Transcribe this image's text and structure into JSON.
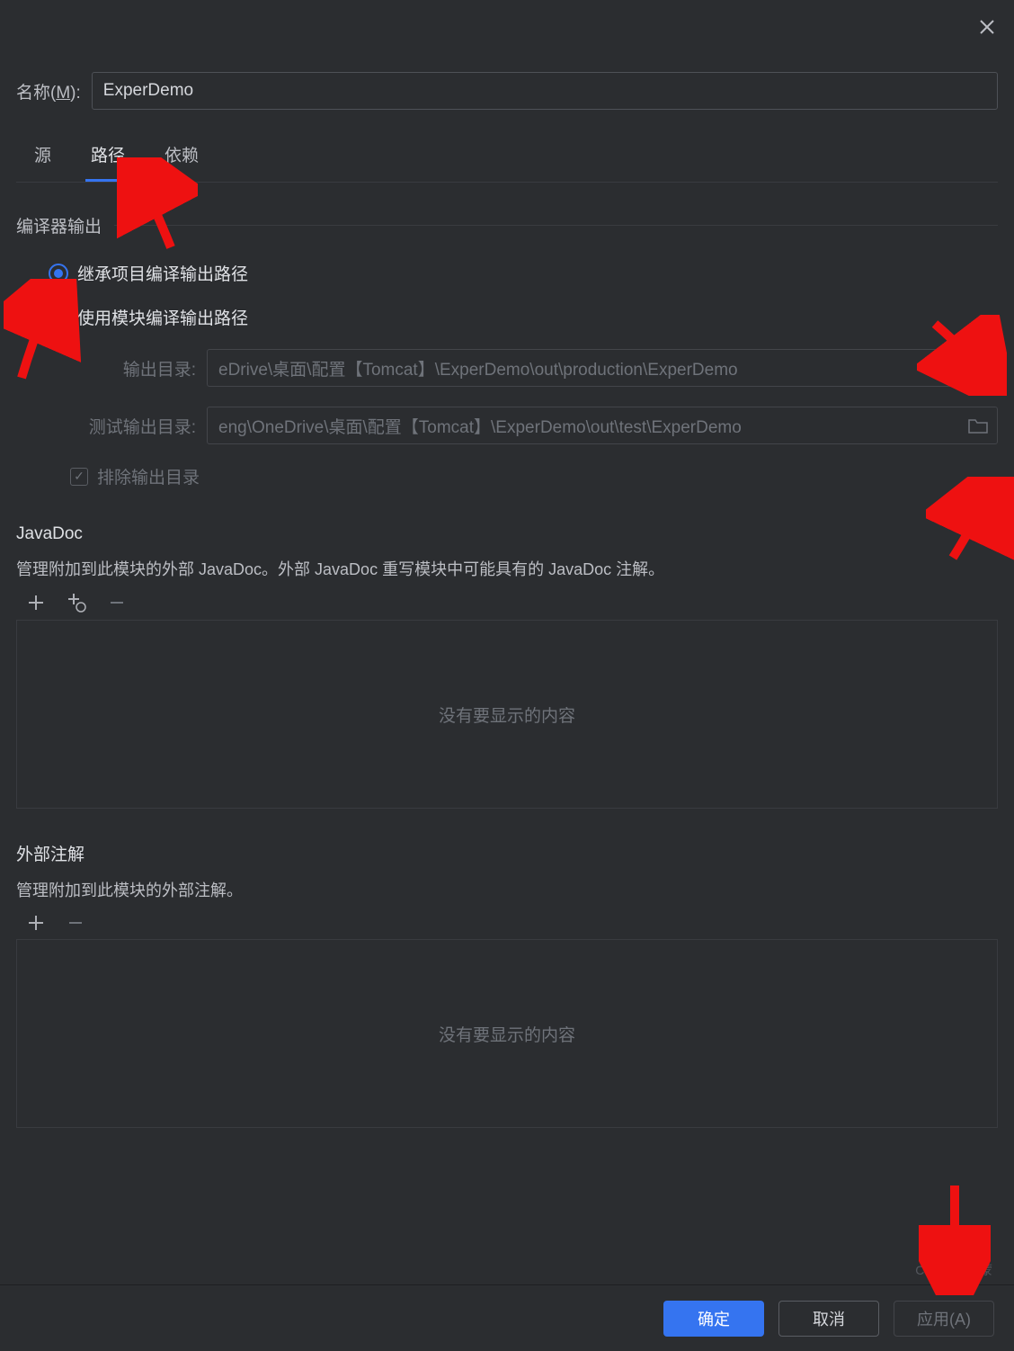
{
  "header": {
    "name_label_prefix": "名称(",
    "name_label_mn": "M",
    "name_label_suffix": "):",
    "name_value": "ExperDemo"
  },
  "tabs": {
    "source": "源",
    "paths": "路径",
    "deps": "依赖"
  },
  "compiler_output": {
    "title": "编译器输出",
    "radio_inherit": "继承项目编译输出路径",
    "radio_module": "使用模块编译输出路径",
    "output_label": "输出目录:",
    "output_value": "eDrive\\桌面\\配置【Tomcat】\\ExperDemo\\out\\production\\ExperDemo",
    "test_output_label": "测试输出目录:",
    "test_output_value": "eng\\OneDrive\\桌面\\配置【Tomcat】\\ExperDemo\\out\\test\\ExperDemo",
    "exclude_label": "排除输出目录"
  },
  "javadoc": {
    "title": "JavaDoc",
    "desc": "管理附加到此模块的外部 JavaDoc。外部 JavaDoc 重写模块中可能具有的 JavaDoc 注解。",
    "empty": "没有要显示的内容"
  },
  "annotations": {
    "title": "外部注解",
    "desc": "管理附加到此模块的外部注解。",
    "empty": "没有要显示的内容"
  },
  "footer": {
    "ok": "确定",
    "cancel": "取消",
    "apply": "应用(A)"
  },
  "watermark": "CSDN @鸿蒙"
}
